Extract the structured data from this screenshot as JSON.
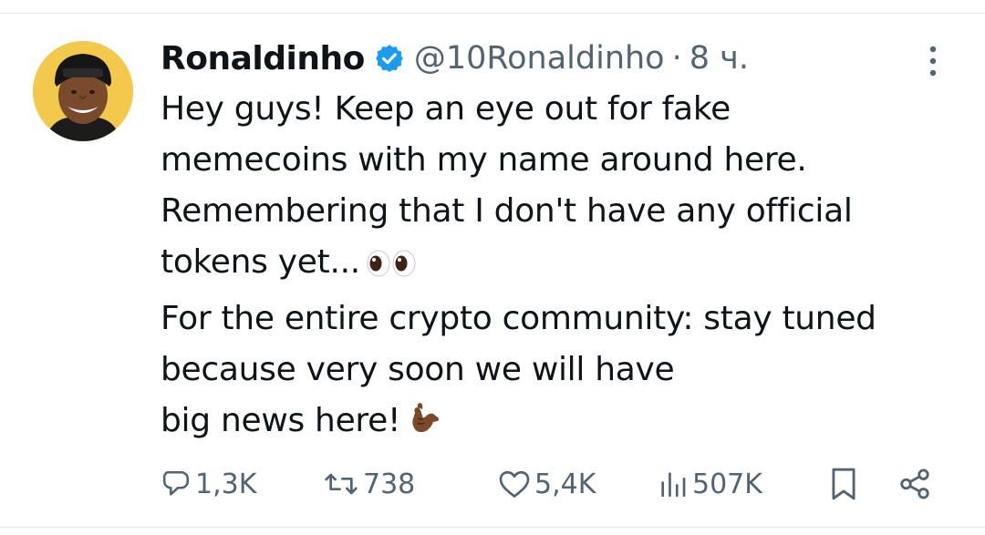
{
  "colors": {
    "text_primary": "#0f1419",
    "text_secondary": "#536471",
    "verified_badge": "#1d9bf0",
    "divider": "#e3e6ea"
  },
  "author": {
    "display_name": "Ronaldinho",
    "handle": "@10Ronaldinho",
    "separator": "·",
    "time": "8 ч.",
    "verified_icon": "verified-badge-icon",
    "avatar_icon": "profile-avatar"
  },
  "tweet": {
    "lines": [
      "Hey guys! Keep an eye out for fake",
      "memecoins with my name around here.",
      "Remembering that I don't have any official",
      "tokens yet...",
      "For the entire crypto community: stay tuned",
      "because very soon we will have",
      "big news here!"
    ],
    "emoji_after_line_4": "eyes-emoji",
    "emoji_after_line_7": "call-me-hand-emoji"
  },
  "actions": {
    "reply_count": "1,3K",
    "retweet_count": "738",
    "like_count": "5,4K",
    "views_count": "507K"
  }
}
